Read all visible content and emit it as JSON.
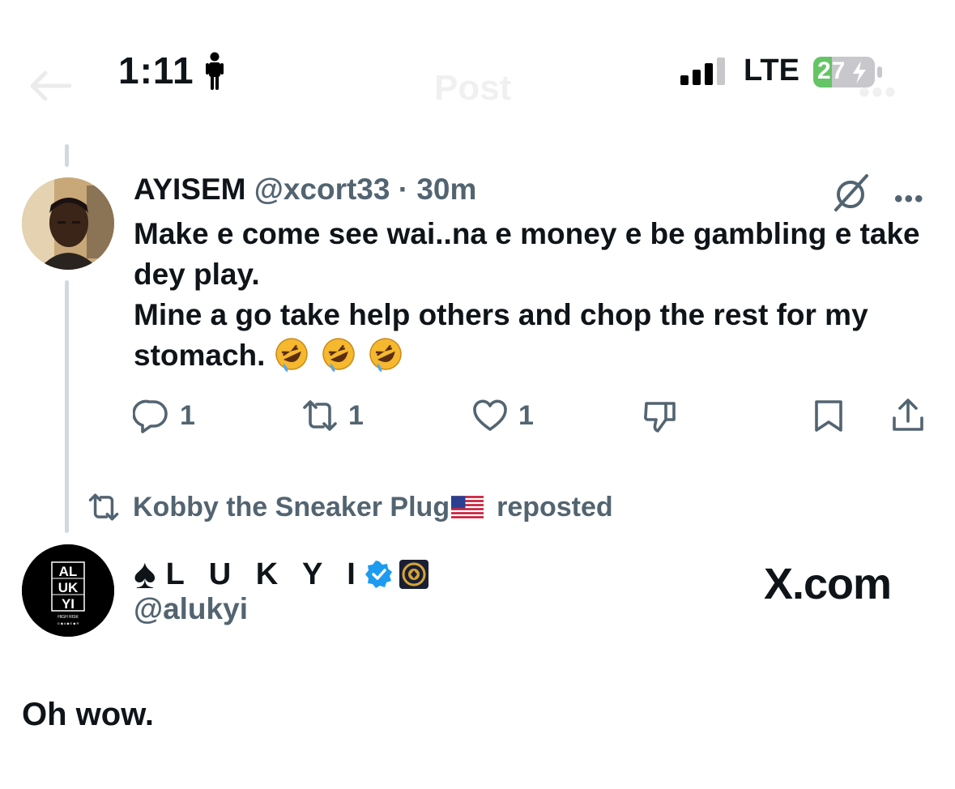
{
  "status_bar": {
    "time": "1:11",
    "network": "LTE",
    "battery": "27"
  },
  "header": {
    "title": "Post"
  },
  "tweet1": {
    "display_name": "AYISEM",
    "meta": "@xcort33 · 30m",
    "body_line1": "Make e come see wai..na e money e be gambling e take dey play.",
    "body_line2": "Mine a go take help others and chop the rest for my stomach.",
    "emoji": "rolling-on-floor-laughing",
    "actions": {
      "replies": "1",
      "reposts": "1",
      "likes": "1"
    }
  },
  "repost": {
    "user": "Kobby the Sneaker Plug",
    "suffix": "reposted"
  },
  "tweet2": {
    "display_name": "L U K Y I",
    "handle": "@alukyi",
    "body": "Oh wow.",
    "avatar_text": {
      "line1": "AL",
      "line2": "UK",
      "line3": "YI",
      "caption": "HIGH RISK",
      "caption2": "G ◆ A ◆ E ◆ R"
    }
  },
  "watermark": "X.com",
  "colors": {
    "text": "#0f1419",
    "secondary": "#536471",
    "verified": "#1d9bf0",
    "battery": "#65c466",
    "thread_line": "#cfd9de"
  }
}
